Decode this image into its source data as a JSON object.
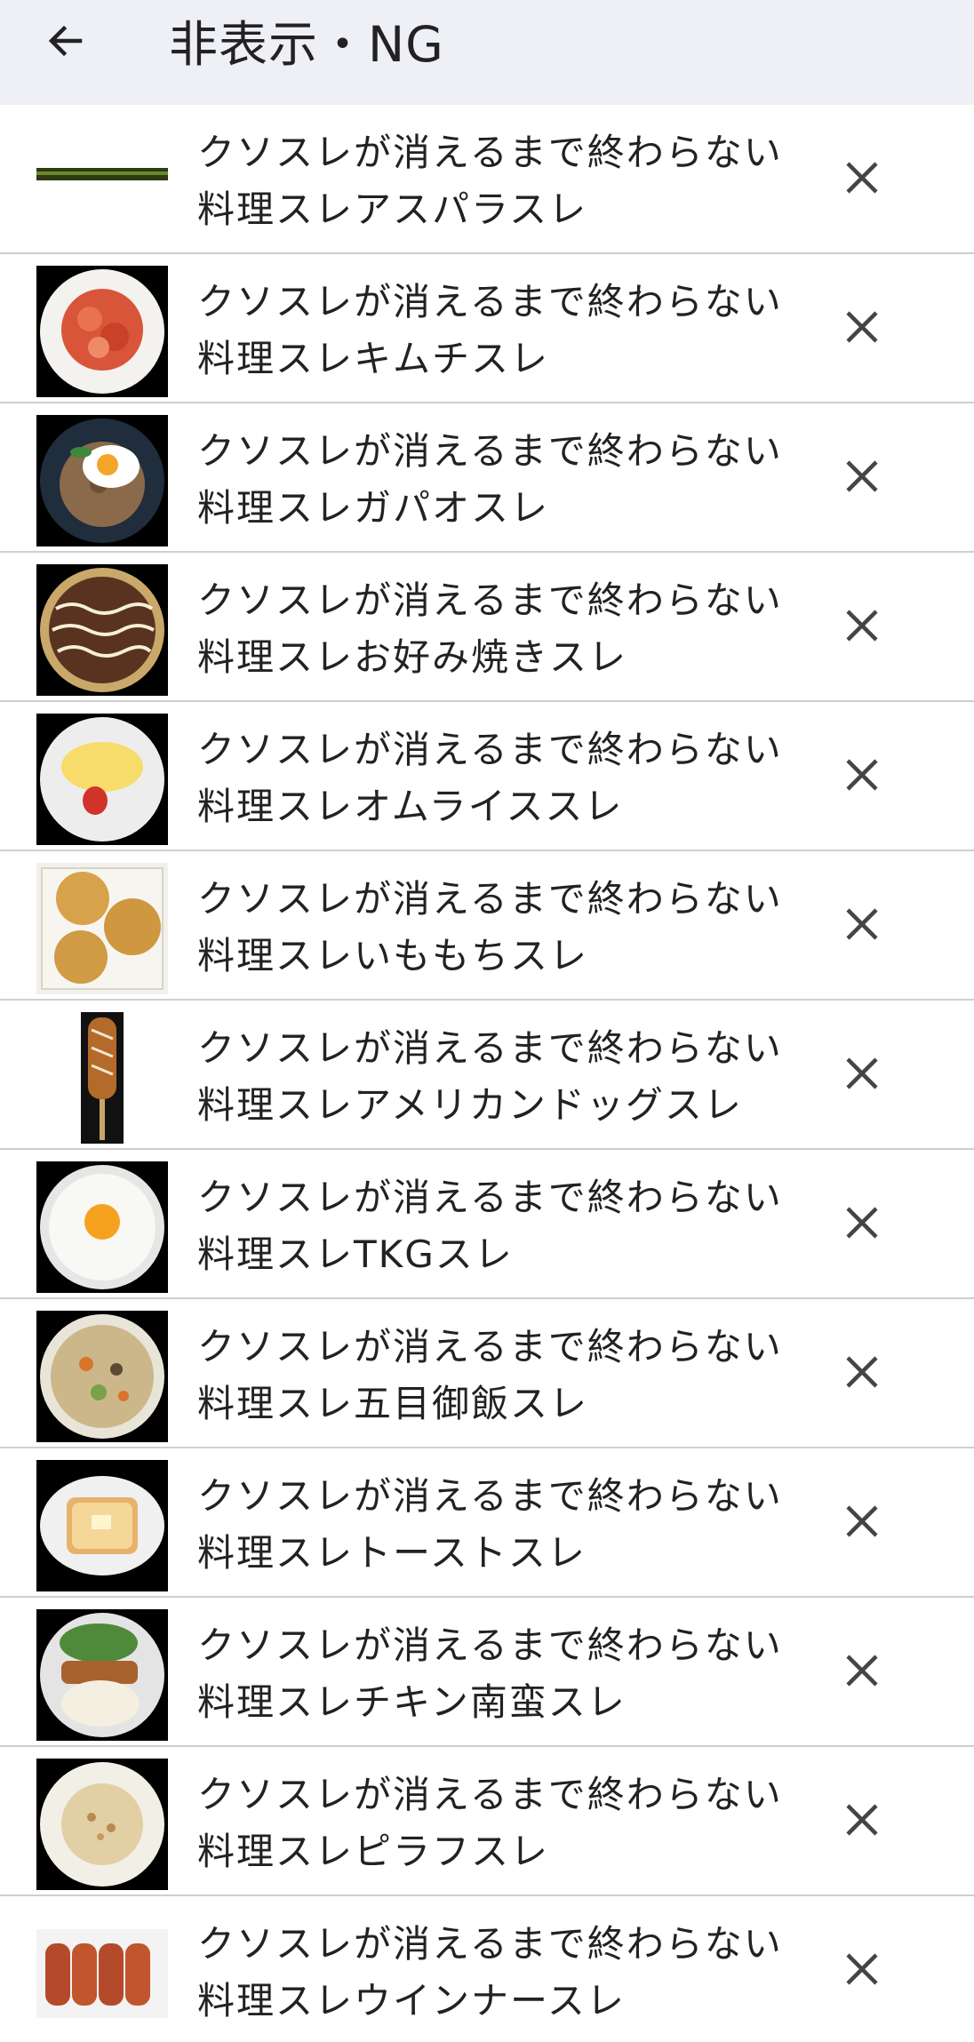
{
  "header": {
    "title": "非表示・NG",
    "back_icon": "arrow-left-icon"
  },
  "items": [
    {
      "line1": "クソスレが消えるまで終わらない",
      "line2": "料理スレアスパラスレ",
      "thumb": "asparagus"
    },
    {
      "line1": "クソスレが消えるまで終わらない",
      "line2": "料理スレキムチスレ",
      "thumb": "kimchi"
    },
    {
      "line1": "クソスレが消えるまで終わらない",
      "line2": "料理スレガパオスレ",
      "thumb": "gapao"
    },
    {
      "line1": "クソスレが消えるまで終わらない",
      "line2": "料理スレお好み焼きスレ",
      "thumb": "okonomiyaki"
    },
    {
      "line1": "クソスレが消えるまで終わらない",
      "line2": "料理スレオムライススレ",
      "thumb": "omurice"
    },
    {
      "line1": "クソスレが消えるまで終わらない",
      "line2": "料理スレいももちスレ",
      "thumb": "imomochi"
    },
    {
      "line1": "クソスレが消えるまで終わらない",
      "line2": "料理スレアメリカンドッグスレ",
      "thumb": "corndog"
    },
    {
      "line1": "クソスレが消えるまで終わらない",
      "line2": "料理スレTKGスレ",
      "thumb": "tkg"
    },
    {
      "line1": "クソスレが消えるまで終わらない",
      "line2": "料理スレ五目御飯スレ",
      "thumb": "gomoku"
    },
    {
      "line1": "クソスレが消えるまで終わらない",
      "line2": "料理スレトーストスレ",
      "thumb": "toast"
    },
    {
      "line1": "クソスレが消えるまで終わらない",
      "line2": "料理スレチキン南蛮スレ",
      "thumb": "chicken-nanban"
    },
    {
      "line1": "クソスレが消えるまで終わらない",
      "line2": "料理スレピラフスレ",
      "thumb": "pilaf"
    },
    {
      "line1": "クソスレが消えるまで終わらない",
      "line2": "料理スレウインナースレ",
      "thumb": "sausage"
    }
  ],
  "row_action_icon": "close-icon",
  "colors": {
    "app_bar_bg": "#eef0f5",
    "divider": "#cfcfcf",
    "text": "#222222"
  }
}
